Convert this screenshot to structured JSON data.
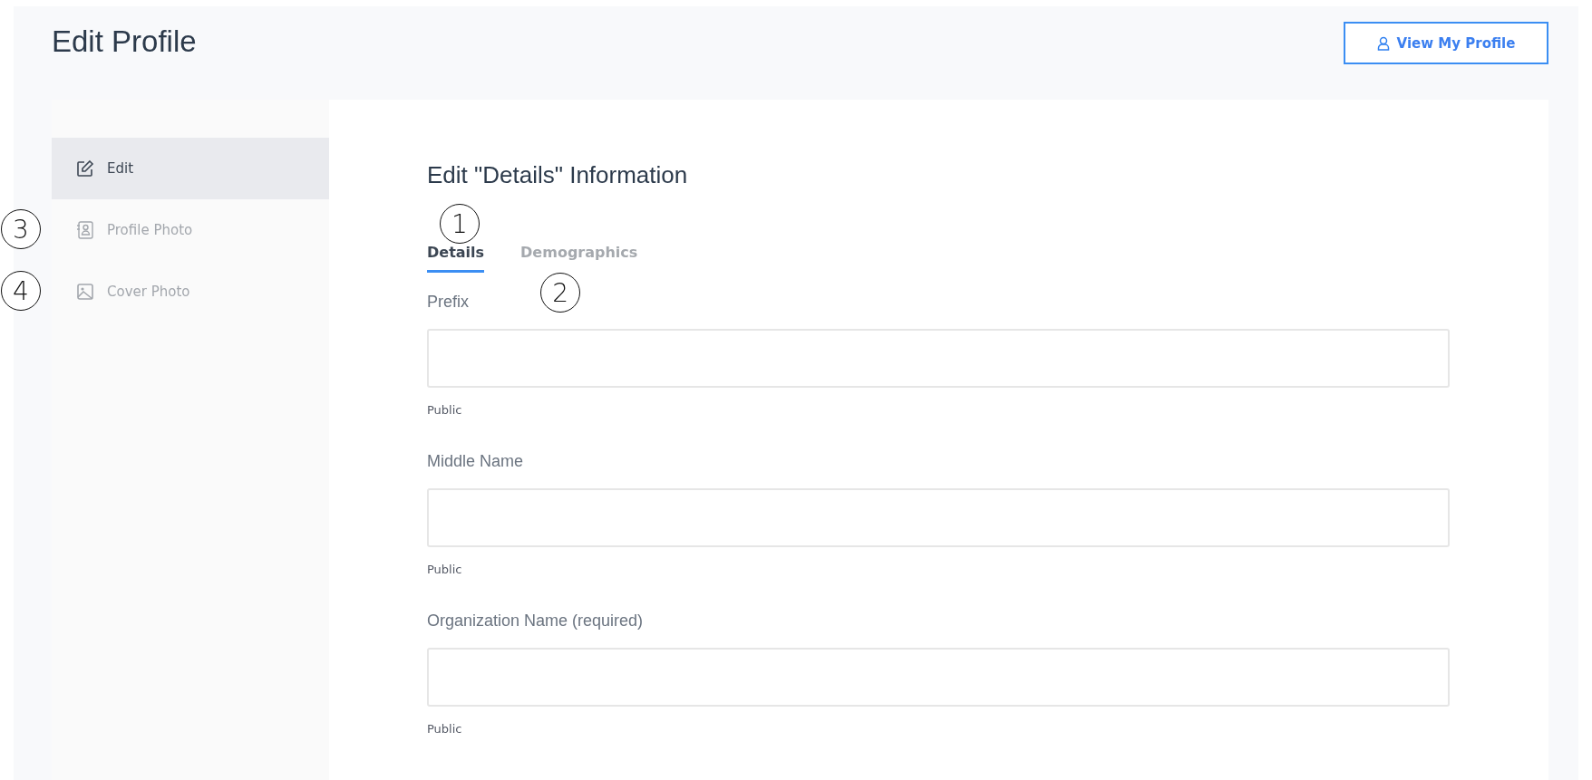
{
  "page": {
    "title": "Edit Profile",
    "view_profile_button": "View My Profile"
  },
  "sidebar": {
    "items": [
      {
        "label": "Edit",
        "selected": true
      },
      {
        "label": "Profile Photo",
        "selected": false,
        "callout": "3"
      },
      {
        "label": "Cover Photo",
        "selected": false,
        "callout": "4"
      }
    ]
  },
  "main": {
    "heading": "Edit \"Details\" Information",
    "tabs": [
      {
        "label": "Details",
        "selected": true,
        "callout": "1"
      },
      {
        "label": "Demographics",
        "selected": false,
        "callout": "2"
      }
    ],
    "fields": [
      {
        "label": "Prefix",
        "note": "Public"
      },
      {
        "label": "Middle Name",
        "note": "Public"
      },
      {
        "label": "Organization Name (required)",
        "note": "Public"
      }
    ]
  }
}
